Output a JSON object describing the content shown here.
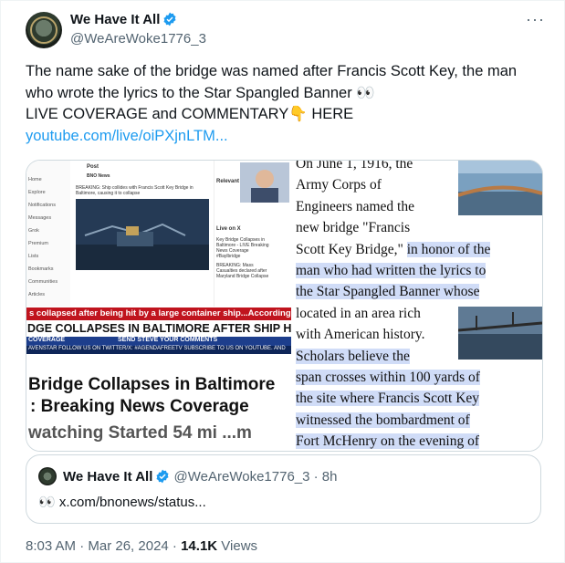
{
  "author": {
    "name": "We Have It All",
    "handle": "@WeAreWoke1776_3"
  },
  "more_label": "···",
  "post": {
    "line1": "The name sake of the bridge was named after Francis Scott Key, the man",
    "line2": "who wrote the lyrics to the Star Spangled Banner 👀",
    "line3": "LIVE COVERAGE and COMMENTARY👇 HERE",
    "link": "youtube.com/live/oiPXjnLTM..."
  },
  "media_left": {
    "nav": [
      "Home",
      "Explore",
      "Notifications",
      "Messages",
      "Grok",
      "Premium",
      "Lists",
      "Bookmarks",
      "Communities",
      "Articles"
    ],
    "feed_header": "Post",
    "feed_source": "BNO News",
    "feed_text": "BREAKING: Ship collides with Francis Scott Key Bridge in Baltimore, causing it to collapse",
    "side_header": "Relevant",
    "side_live": "Live on X",
    "side_item1": "Key Bridge Collapses in Baltimore - LIVE Breaking News Coverage #Baylbridge",
    "side_item2": "BREAKING: Mass Casualties declared after Maryland Bridge Collapse",
    "ticker1": "s collapsed after being hit by a large container ship...According to scanner traffic, a",
    "ticker2": "DGE COLLAPSES IN BALTIMORE AFTER SHIP HITS IT",
    "ticker3_a": "COVERAGE",
    "ticker3_b": "SEND STEVE YOUR COMMENTS",
    "ticker4": "AVENSTAR    FOLLOW US ON TWITTER/X: #AGENDAFREETV    SUBSCRIBE TO US ON YOUTUBE. AND",
    "big1": "Bridge Collapses in Baltimore",
    "big2": ": Breaking News Coverage",
    "watch": "watching  Started 54 mi  ...m"
  },
  "media_right": {
    "lines": [
      {
        "text": "On June 1, 1916, the",
        "hl": false
      },
      {
        "text": "Army Corps of",
        "hl": false
      },
      {
        "text": "Engineers named the",
        "hl": false
      },
      {
        "text": "new bridge \"Francis",
        "hl": false
      },
      {
        "text_a": "Scott Key Bridge,\" ",
        "text_b": "in honor of the",
        "hl": "partial"
      },
      {
        "text": "man who had written the lyrics to",
        "hl": true
      },
      {
        "text": "the Star Spangled Banner whose",
        "hl": true
      },
      {
        "text": "located in an area rich",
        "hl": false
      },
      {
        "text": "with American history.",
        "hl": false
      },
      {
        "text": "Scholars believe the",
        "hl": true
      },
      {
        "text": "span crosses within 100 yards of",
        "hl": true
      },
      {
        "text": "the site where Francis Scott Key",
        "hl": true
      },
      {
        "text": "witnessed the bombardment of",
        "hl": true
      },
      {
        "text": "Fort McHenry on the evening of",
        "hl": true
      }
    ]
  },
  "quote": {
    "name": "We Have It All",
    "handle_time": "@WeAreWoke1776_3 · 8h",
    "text": "👀 x.com/bnonews/status..."
  },
  "meta": {
    "time": "8:03 AM · Mar 26, 2024 · ",
    "views_count": "14.1K",
    "views_label": " Views"
  },
  "colors": {
    "link": "#1d9bf0",
    "verified": "#1d9bf0",
    "highlight": "#d0dcf7"
  }
}
